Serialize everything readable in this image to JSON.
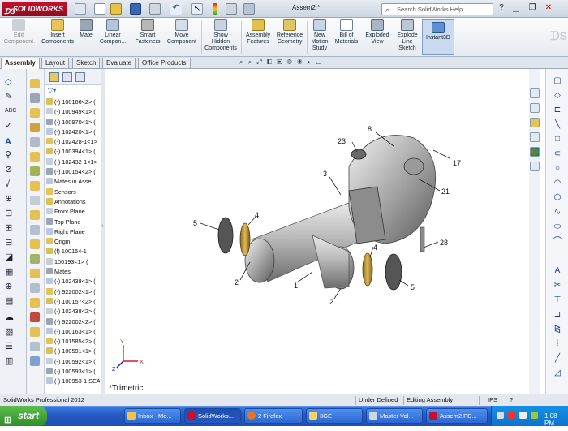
{
  "app": {
    "logo": "SOLIDWORKS",
    "document_title": "Assem2 *",
    "search_placeholder": "Search SolidWorks Help"
  },
  "ribbon": [
    {
      "label": "Edit\nComponent",
      "disabled": true
    },
    {
      "label": "Insert\nComponents"
    },
    {
      "label": "Mate"
    },
    {
      "label": "Linear\nCompon..."
    },
    {
      "label": "Smart\nFasteners"
    },
    {
      "label": "Move\nComponent"
    },
    {
      "label": "Show\nHidden\nComponents"
    },
    {
      "label": "Assembly\nFeatures"
    },
    {
      "label": "Reference\nGeometry"
    },
    {
      "label": "New\nMotion\nStudy"
    },
    {
      "label": "Bill of\nMaterials"
    },
    {
      "label": "Exploded\nView"
    },
    {
      "label": "Explode\nLine\nSketch"
    },
    {
      "label": "Instant3D"
    }
  ],
  "tabs": [
    "Assembly",
    "Layout",
    "Sketch",
    "Evaluate",
    "Office Products"
  ],
  "tree": [
    "(-) 100166<2> (",
    "(-) 100949<1> (",
    "(-) 100970<1> (",
    "(-) 102420<1> (",
    "(-) 102428-1<1>",
    "(-) 100394<1> (",
    "(-) 102432-1<1>",
    "(-) 100154<2> (",
    "Mates in Asse",
    "Sensors",
    "Annotations",
    "Front Plane",
    "Top Plane",
    "Right Plane",
    "Origin",
    "(f) 100154-1",
    "100193<1> (",
    "Mates",
    "(-) 102438<1> (",
    "(-) 922002<1> (",
    "(-) 100157<2> (",
    "(-) 102438<2> (",
    "(-) 922002<2> (",
    "(-) 100163<1> (",
    "(-) 101585<2> (",
    "(-) 100591<1> (",
    "(-) 100592<1> (",
    "(-) 100593<1> (",
    "(-) 100953-1 SEA"
  ],
  "viewport": {
    "view_label": "*Trimetric",
    "callouts": [
      "23",
      "8",
      "17",
      "3",
      "21",
      "5",
      "4",
      "4",
      "28",
      "2",
      "1",
      "2",
      "5"
    ],
    "triad": {
      "x": "X",
      "y": "Y",
      "z": "Z"
    }
  },
  "status": {
    "product": "SolidWorks Professional 2012",
    "state": "Under Defined",
    "mode": "Editing Assembly",
    "units": "IPS",
    "help": "?"
  },
  "taskbar": {
    "start": "start",
    "tasks": [
      "Inbox - Mo...",
      "SolidWorks...",
      "2 Firefox",
      "3GE",
      "Master Vol...",
      "Assem2.PD..."
    ],
    "clock": "1:08 PM"
  },
  "colors": {
    "ribbon_accent": "#1a4c8c",
    "part": "#b8b8b8",
    "taskbar": "#245ac4",
    "start": "#3aa034"
  }
}
